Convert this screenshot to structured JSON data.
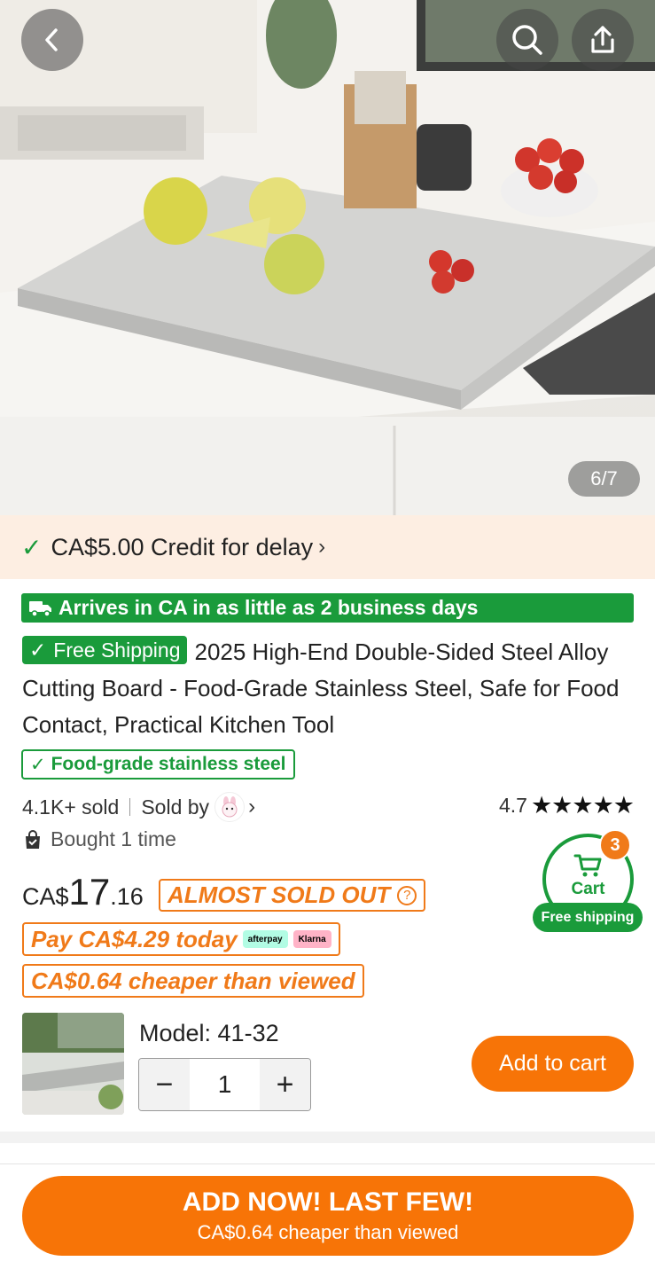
{
  "hero": {
    "counter": "6/7",
    "back_icon": "chevron-left-icon",
    "search_icon": "search-icon",
    "share_icon": "share-icon"
  },
  "credit": {
    "text": "CA$5.00 Credit for delay",
    "chevron": "›"
  },
  "arrival": {
    "text": "Arrives in CA in as little as 2 business days"
  },
  "product": {
    "free_shipping": "Free Shipping",
    "title": "2025 High-End Double-Sided Steel Alloy Cutting Board - Food-Grade Stainless Steel, Safe for Food Contact, Practical Kitchen Tool",
    "tag": "Food-grade stainless steel",
    "sold": "4.1K+ sold",
    "sold_by": "Sold by",
    "rating": "4.7",
    "stars": "★★★★★",
    "bought": "Bought 1 time"
  },
  "price": {
    "currency": "CA$",
    "whole": "17",
    "decimal": ".16",
    "almost_sold_out": "ALMOST SOLD OUT",
    "pay_today": "Pay CA$4.29 today",
    "afterpay": "afterpay",
    "klarna": "Klarna",
    "cheaper": "CA$0.64 cheaper than viewed"
  },
  "cart": {
    "label": "Cart",
    "count": "3",
    "free": "Free shipping"
  },
  "model": {
    "label": "Model: 41-32",
    "quantity": "1",
    "minus": "−",
    "plus": "+",
    "add_to_cart": "Add to cart"
  },
  "bottom": {
    "cta": "ADD NOW! LAST FEW!",
    "sub": "CA$0.64 cheaper than viewed"
  },
  "colors": {
    "green": "#1a9b3b",
    "orange": "#f77407",
    "orange_text": "#f07a19",
    "credit_bg": "#fdeee2"
  }
}
